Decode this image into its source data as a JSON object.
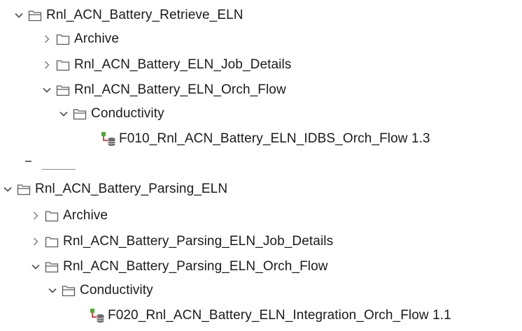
{
  "tree": {
    "groups": [
      {
        "name": "Rnl_ACN_Battery_Retrieve_ELN",
        "expanded": true,
        "children": [
          {
            "name": "Archive",
            "expanded": false
          },
          {
            "name": "Rnl_ACN_Battery_ELN_Job_Details",
            "expanded": false
          },
          {
            "name": "Rnl_ACN_Battery_ELN_Orch_Flow",
            "expanded": true
          },
          {
            "name": "Conductivity",
            "expanded": true
          },
          {
            "name": "F010_Rnl_ACN_Battery_ELN_IDBS_Orch_Flow 1.3",
            "type": "flow"
          }
        ]
      },
      {
        "name": "Rnl_ACN_Battery_Parsing_ELN",
        "expanded": true,
        "children": [
          {
            "name": "Archive",
            "expanded": false
          },
          {
            "name": "Rnl_ACN_Battery_Parsing_ELN_Job_Details",
            "expanded": false
          },
          {
            "name": "Rnl_ACN_Battery_Parsing_ELN_Orch_Flow",
            "expanded": true
          },
          {
            "name": "Conductivity",
            "expanded": true
          },
          {
            "name": "F020_Rnl_ACN_Battery_ELN_Integration_Orch_Flow 1.1",
            "type": "flow"
          }
        ]
      }
    ]
  },
  "colors": {
    "chevron": "#555555",
    "folder_outline": "#5a5a5a",
    "flow_connector": "#e0454a",
    "flow_node": "#4caf2a",
    "flow_db": "#6b6b6b"
  },
  "icons": {
    "expanded": "chevron-down-icon",
    "collapsed": "chevron-right-icon",
    "folder_closed": "folder-icon",
    "folder_open": "folder-open-icon",
    "flow": "orchestration-flow-icon"
  }
}
